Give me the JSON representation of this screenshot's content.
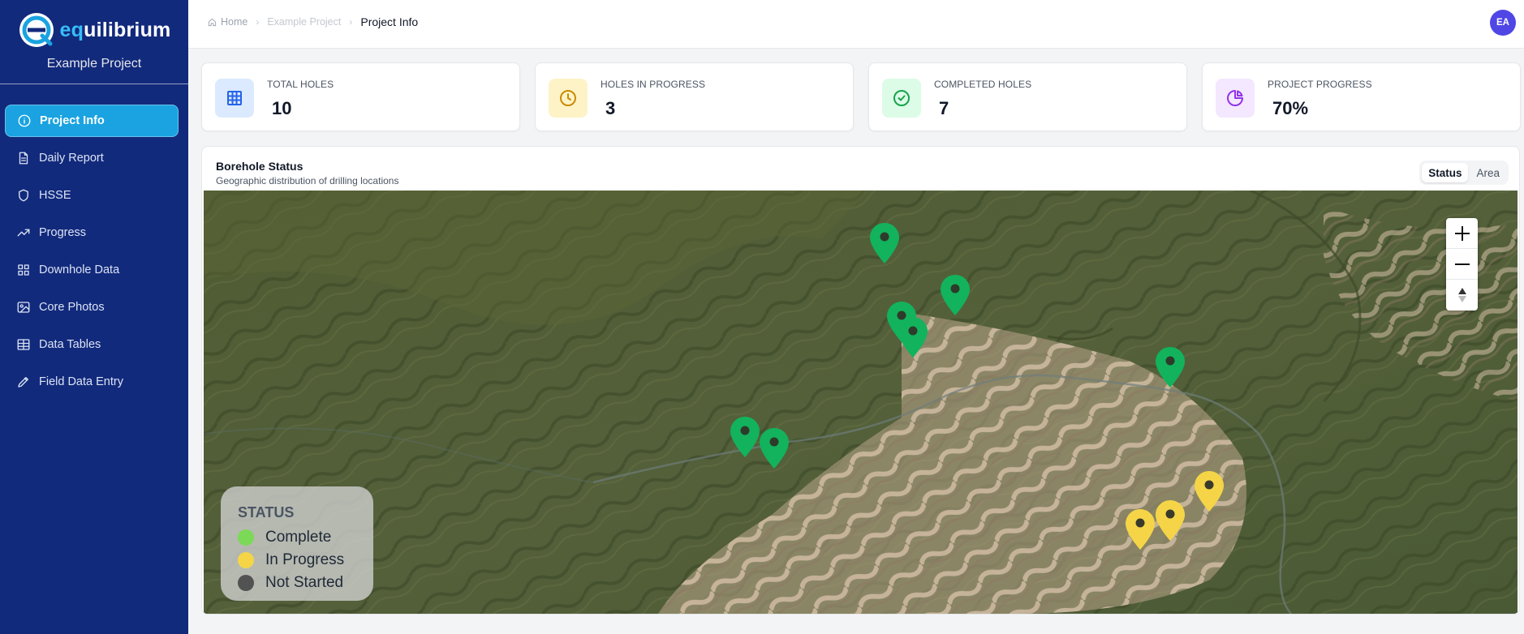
{
  "app": {
    "brand_prefix": "eq",
    "brand_suffix": "uilibrium",
    "project_name": "Example Project"
  },
  "sidebar": {
    "items": [
      {
        "label": "Project Info",
        "icon": "info-icon",
        "active": true
      },
      {
        "label": "Daily Report",
        "icon": "file-icon"
      },
      {
        "label": "HSSE",
        "icon": "shield-icon"
      },
      {
        "label": "Progress",
        "icon": "trending-up-icon"
      },
      {
        "label": "Downhole Data",
        "icon": "grid-icon"
      },
      {
        "label": "Core Photos",
        "icon": "image-icon"
      },
      {
        "label": "Data Tables",
        "icon": "table-icon"
      },
      {
        "label": "Field Data Entry",
        "icon": "pencil-icon"
      }
    ]
  },
  "header": {
    "breadcrumb": [
      "Home",
      "Example Project",
      "Project Info"
    ],
    "user_initials": "EA"
  },
  "stats": [
    {
      "label": "TOTAL HOLES",
      "value": "10",
      "icon": "table-grid-icon",
      "color": "#2563eb",
      "bg": "#dbeafe"
    },
    {
      "label": "HOLES IN PROGRESS",
      "value": "3",
      "icon": "clock-icon",
      "color": "#ca8a04",
      "bg": "#fef3c7"
    },
    {
      "label": "COMPLETED HOLES",
      "value": "7",
      "icon": "check-circle-icon",
      "color": "#16a34a",
      "bg": "#dcfce7"
    },
    {
      "label": "PROJECT PROGRESS",
      "value": "70%",
      "icon": "pie-chart-icon",
      "color": "#9333ea",
      "bg": "#f3e8ff"
    }
  ],
  "map_panel": {
    "title": "Borehole Status",
    "subtitle": "Geographic distribution of drilling locations",
    "toggle": [
      "Status",
      "Area"
    ],
    "active_toggle": "Status",
    "legend": {
      "title": "STATUS",
      "items": [
        {
          "label": "Complete",
          "color": "#7cd957"
        },
        {
          "label": "In Progress",
          "color": "#f5d547"
        },
        {
          "label": "Not Started",
          "color": "#525252"
        }
      ]
    }
  },
  "colors": {
    "sidebar_bg": "#122a7c",
    "active_nav": "#1aa3e0",
    "complete_marker": "#12b35c",
    "in_progress_marker": "#f5d547"
  }
}
